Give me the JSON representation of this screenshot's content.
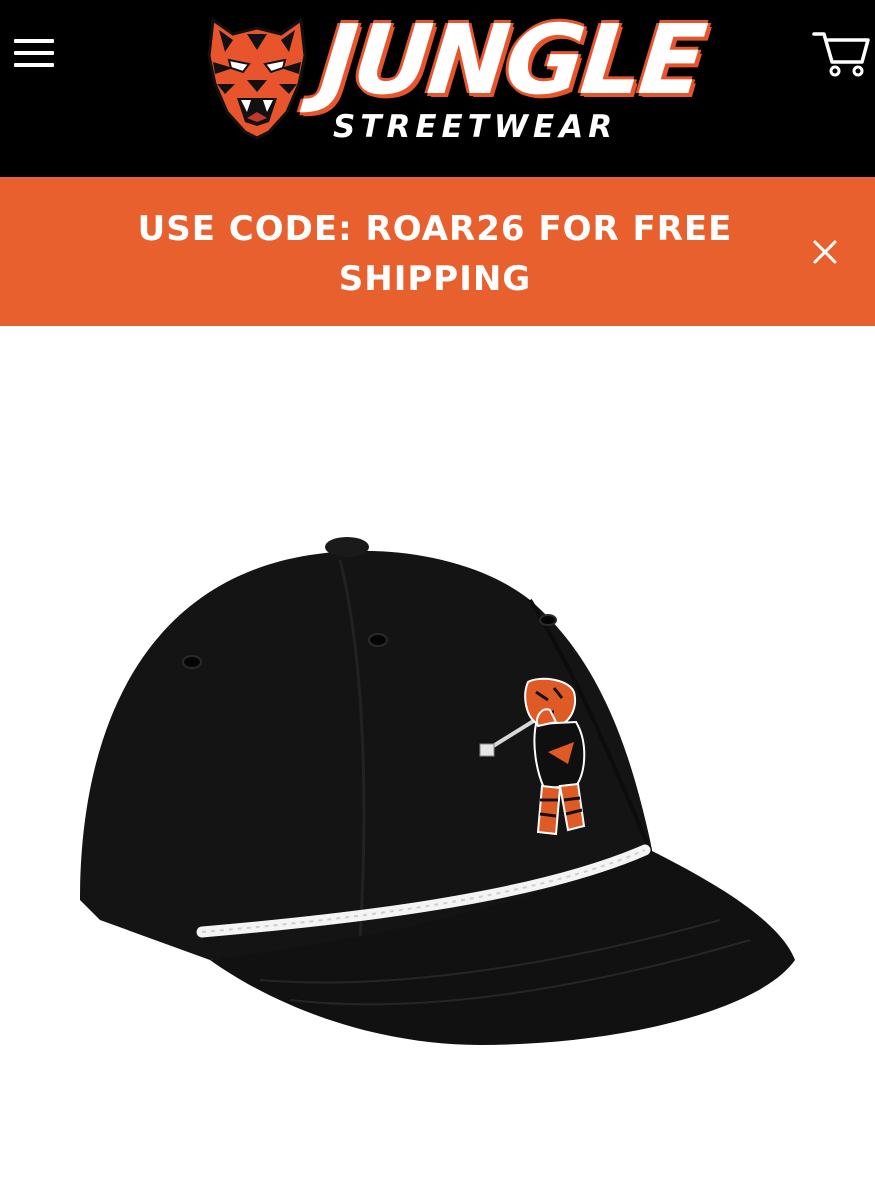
{
  "header": {
    "brand": {
      "name": "JUNGLE",
      "tagline": "STREETWEAR"
    },
    "menu_icon": "hamburger-menu-icon",
    "cart_icon": "shopping-cart-icon",
    "background_color": "#000000"
  },
  "promo_banner": {
    "text": "USE CODE: ROAR26 FOR FREE SHIPPING",
    "close_icon": "close-icon",
    "background_color": "#e9602f"
  },
  "product": {
    "image_subject": "black rope snapback hat with embroidered golfing tiger",
    "accent_color": "#e8542b",
    "rope_color": "#ffffff"
  }
}
